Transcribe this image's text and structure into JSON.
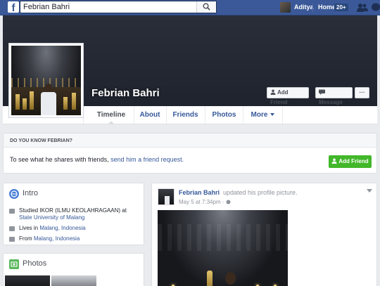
{
  "topbar": {
    "brand_letter": "f",
    "search_value": "Febrian Bahri",
    "user_name": "Aditya",
    "home_label": "Home",
    "home_badge": "20+"
  },
  "profile": {
    "name": "Febrian Bahri",
    "add_friend_label": "Add Friend",
    "message_label": "Message",
    "more_label": "···"
  },
  "tabs": [
    {
      "label": "Timeline"
    },
    {
      "label": "About"
    },
    {
      "label": "Friends"
    },
    {
      "label": "Photos"
    },
    {
      "label": "More"
    }
  ],
  "know_box": {
    "heading": "DO YOU KNOW FEBRIAN?",
    "text_prefix": "To see what he shares with friends, ",
    "link": "send him a friend request.",
    "button_label": "Add Friend"
  },
  "intro": {
    "title": "Intro",
    "studied_prefix": "Studied IKOR (ILMU KEOLAHRAGAAN) at ",
    "studied_school": "State University of Malang",
    "lives_prefix": "Lives in ",
    "lives_place": "Malang, Indonesia",
    "from_prefix": "From ",
    "from_place": "Malang, Indonesia"
  },
  "photos": {
    "title": "Photos"
  },
  "post": {
    "author": "Febrian Bahri",
    "action": "updated his profile picture.",
    "timestamp": "May 5 at 7:34pm · ",
    "privacy_icon": "globe-icon"
  },
  "colors": {
    "brand": "#3b5998",
    "link": "#365899",
    "green": "#42b72a",
    "intro_icon": "#4a7fd6",
    "photos_icon": "#5bb85d"
  }
}
